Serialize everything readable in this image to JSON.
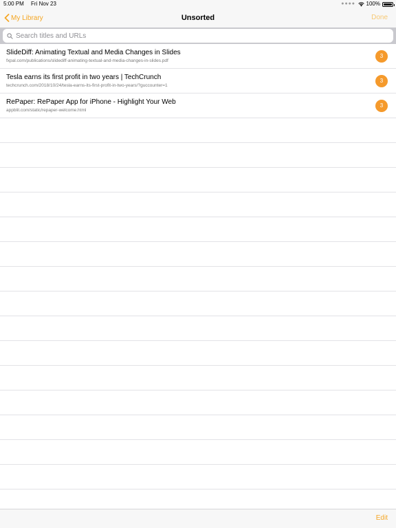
{
  "status_bar": {
    "time": "5:00 PM",
    "date": "Fri Nov 23",
    "battery": "100%"
  },
  "nav": {
    "back_label": "My Library",
    "title": "Unsorted",
    "done_label": "Done"
  },
  "search": {
    "placeholder": "Search titles and URLs"
  },
  "items": [
    {
      "title": "SlideDiff: Animating Textual and Media Changes in Slides",
      "url": "fxpal.com/publications/slidediff-animating-textual-and-media-changes-in-slides.pdf",
      "count": "3"
    },
    {
      "title": "Tesla earns its first profit in two years | TechCrunch",
      "url": "techcrunch.com/2018/10/24/tesla-earns-its-first-profit-in-two-years/?guccounter=1",
      "count": "3"
    },
    {
      "title": "RePaper: RePaper App for iPhone - Highlight Your Web",
      "url": "appblit.com/static/repaper-welcome.html",
      "count": "3"
    }
  ],
  "toolbar": {
    "edit_label": "Edit"
  },
  "colors": {
    "accent": "#f5a623",
    "badge": "#f59a2c"
  }
}
